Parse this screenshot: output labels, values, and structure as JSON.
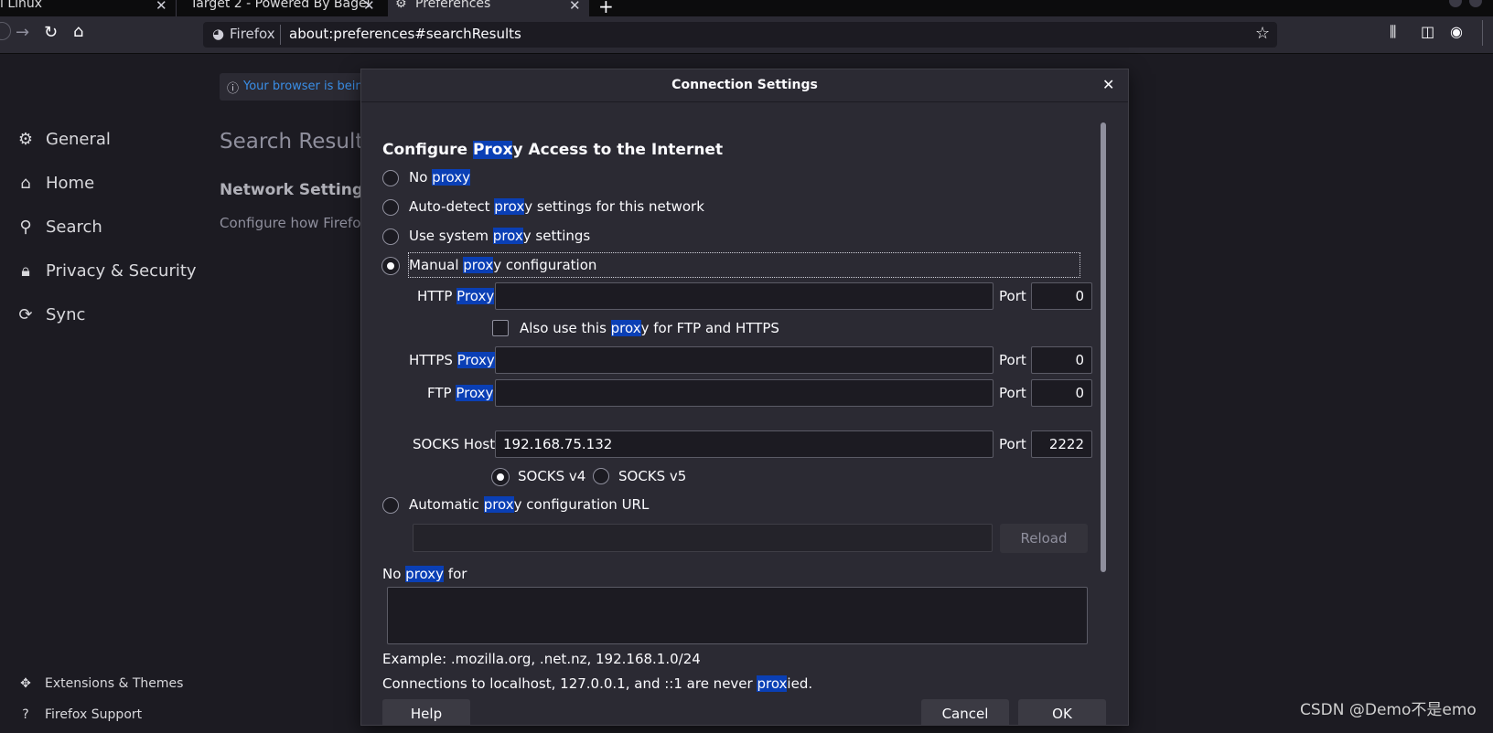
{
  "tabs": [
    {
      "title": "i Linux"
    },
    {
      "title": "Target 2 - Powered By Bagel"
    },
    {
      "title": "Preferences"
    }
  ],
  "urlbar": {
    "identity": "Firefox",
    "url": "about:preferences#searchResults"
  },
  "watermark": "CSDN @Demo不是emo",
  "prefs": {
    "notice": "Your browser is being",
    "sidebar": [
      {
        "icon": "gear-icon",
        "label": "General"
      },
      {
        "icon": "home-icon",
        "label": "Home"
      },
      {
        "icon": "search-icon",
        "label": "Search"
      },
      {
        "icon": "lock-icon",
        "label": "Privacy & Security"
      },
      {
        "icon": "sync-icon",
        "label": "Sync"
      }
    ],
    "footer": [
      {
        "icon": "puzzle-icon",
        "label": "Extensions & Themes"
      },
      {
        "icon": "help-icon",
        "label": "Firefox Support"
      }
    ],
    "search_results_title": "Search Results",
    "network_heading": "Network Settings",
    "network_desc": "Configure how Firefo"
  },
  "dialog": {
    "title": "Connection Settings",
    "heading": [
      "Configure ",
      "Prox",
      "y Access to the Internet"
    ],
    "options": {
      "no_proxy": [
        "No ",
        "proxy"
      ],
      "auto_detect": [
        "Auto-detect ",
        "prox",
        "y settings for this network"
      ],
      "system": [
        "Use system ",
        "prox",
        "y settings"
      ],
      "manual": [
        "Manual ",
        "prox",
        "y configuration"
      ],
      "automatic_url": [
        "Automatic ",
        "prox",
        "y configuration URL"
      ]
    },
    "selected_option": "manual",
    "http_proxy_label": [
      "HTTP ",
      "Proxy"
    ],
    "http_proxy_value": "",
    "http_port": "0",
    "also_use": [
      "Also use this ",
      "prox",
      "y for FTP and HTTPS"
    ],
    "also_use_checked": false,
    "https_proxy_label": [
      "HTTPS ",
      "Proxy"
    ],
    "https_proxy_value": "",
    "https_port": "0",
    "ftp_proxy_label": [
      "FTP ",
      "Proxy"
    ],
    "ftp_proxy_value": "",
    "ftp_port": "0",
    "socks_host_label": "SOCKS Host",
    "socks_host_value": "192.168.75.132",
    "socks_port": "2222",
    "port_label": "Port",
    "socks_v4": "SOCKS v4",
    "socks_v5": "SOCKS v5",
    "socks_selected": "v4",
    "auto_url_value": "",
    "reload_label": "Reload",
    "no_proxy_for": [
      "No ",
      "proxy",
      " for"
    ],
    "no_proxy_value": "",
    "example": "Example: .mozilla.org, .net.nz, 192.168.1.0/24",
    "localhost_note": [
      "Connections to localhost, 127.0.0.1, and ::1 are never ",
      "prox",
      "ied."
    ],
    "buttons": {
      "help": "Help",
      "cancel": "Cancel",
      "ok": "OK"
    }
  }
}
